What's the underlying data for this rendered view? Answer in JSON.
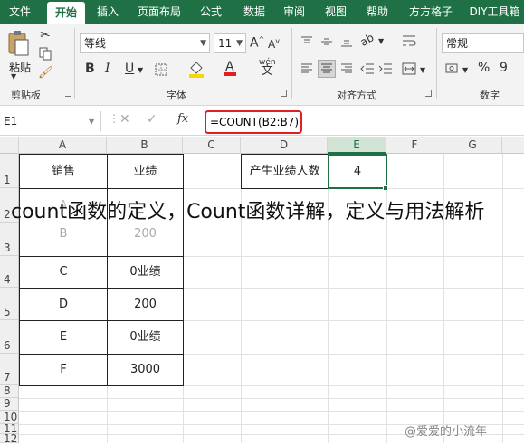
{
  "tabs": [
    "文件",
    "开始",
    "插入",
    "页面布局",
    "公式",
    "数据",
    "审阅",
    "视图",
    "帮助",
    "方方格子",
    "DIY工具箱"
  ],
  "ribbon": {
    "clipboard": {
      "paste_label": "粘贴",
      "group_label": "剪贴板"
    },
    "font": {
      "font_name": "等线",
      "font_size": "11",
      "group_label": "字体",
      "bold": "B",
      "italic": "I",
      "underline": "U",
      "grow": "A",
      "shrink": "A",
      "wen": "wén",
      "accent_red": "#e02020",
      "accent_yellow": "#f5d800"
    },
    "alignment": {
      "group_label": "对齐方式"
    },
    "number": {
      "format": "常规",
      "group_label": "数字",
      "percent": "%",
      "comma": "9"
    }
  },
  "formula_bar": {
    "name_box": "E1",
    "fx": "fx",
    "formula": "=COUNT(B2:B7)"
  },
  "columns": [
    "A",
    "B",
    "C",
    "D",
    "E",
    "F",
    "G"
  ],
  "rows": [
    "1",
    "2",
    "3",
    "4",
    "5",
    "6",
    "7",
    "8",
    "9",
    "10",
    "11",
    "12"
  ],
  "cells": {
    "A1": "销售",
    "B1": "业绩",
    "A2": "A",
    "B2": "",
    "A3": "B",
    "B3": "200",
    "A4": "C",
    "B4": "0业绩",
    "A5": "D",
    "B5": "200",
    "A6": "E",
    "B6": "0业绩",
    "A7": "F",
    "B7": "3000",
    "D1": "产生业绩人数",
    "E1": "4"
  },
  "overlay_title": "count函数的定义，Count函数详解，定义与用法解析",
  "credit": "@爱爱的小流年"
}
